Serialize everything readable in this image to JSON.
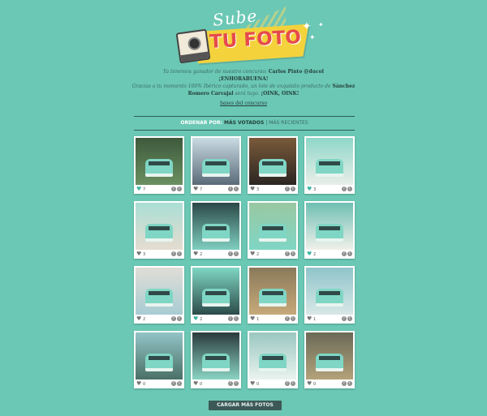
{
  "logo": {
    "sube": "Sube",
    "tufoto": "TU FOTO"
  },
  "intro": {
    "line1_prefix": "Ya tenemos ganador de nuestro concurso:",
    "winner": "Carlos Pinto @ducol",
    "congrats": "¡ENHORABUENA!",
    "line3": "Gracias a tu momento 100% Ibérico capturado, un lote de exquisito producto de",
    "brand": "Sánchez Romero Carvajal",
    "line4": "será tuyo.",
    "oink": "¡OINK, OINK!",
    "bases_link": "bases del concurso"
  },
  "filter": {
    "label": "ORDENAR POR:",
    "most_voted": "MÁS VOTADOS",
    "separator": "|",
    "most_recent": "MÁS RECIENTES"
  },
  "photos": [
    {
      "votes": "7",
      "liked": true,
      "bg": "#3e5a3c",
      "accent": "#6a8f60"
    },
    {
      "votes": "7",
      "liked": false,
      "bg": "#c9dbe3",
      "accent": "#5b6a78"
    },
    {
      "votes": "3",
      "liked": false,
      "bg": "#7a5a3a",
      "accent": "#2c2622"
    },
    {
      "votes": "3",
      "liked": true,
      "bg": "#8fd7c8",
      "accent": "#e8eee8"
    },
    {
      "votes": "3",
      "liked": false,
      "bg": "#a9ded4",
      "accent": "#e6dcd0"
    },
    {
      "votes": "2",
      "liked": false,
      "bg": "#2b4848",
      "accent": "#7fcfc0"
    },
    {
      "votes": "2",
      "liked": false,
      "bg": "#9ac8a2",
      "accent": "#7fd6c4"
    },
    {
      "votes": "2",
      "liked": true,
      "bg": "#6fbfb3",
      "accent": "#f0f0ea"
    },
    {
      "votes": "2",
      "liked": false,
      "bg": "#e0ddd6",
      "accent": "#a8ccd3"
    },
    {
      "votes": "2",
      "liked": true,
      "bg": "#7fd6c4",
      "accent": "#2c4b49"
    },
    {
      "votes": "1",
      "liked": false,
      "bg": "#8a7a5a",
      "accent": "#c7a97a"
    },
    {
      "votes": "1",
      "liked": false,
      "bg": "#8fc5ca",
      "accent": "#d8e7e6"
    },
    {
      "votes": "0",
      "liked": false,
      "bg": "#92c4c7",
      "accent": "#4b7066"
    },
    {
      "votes": "0",
      "liked": false,
      "bg": "#2a3a3c",
      "accent": "#8ad4c4"
    },
    {
      "votes": "0",
      "liked": false,
      "bg": "#9bc7c0",
      "accent": "#e9f3ef"
    },
    {
      "votes": "0",
      "liked": false,
      "bg": "#6a6a58",
      "accent": "#b3a27a"
    }
  ],
  "load_more": "CARGAR MÁS FOTOS",
  "colors": {
    "background": "#6bc8b5",
    "logo_banner": "#f4d23c",
    "logo_text": "#e64b4b",
    "button": "#3d5957"
  },
  "icons": {
    "heart": "heart-icon",
    "facebook": "facebook-share-icon",
    "twitter": "twitter-share-icon",
    "camera": "polaroid-camera-icon",
    "sparkle": "sparkle-icon"
  }
}
